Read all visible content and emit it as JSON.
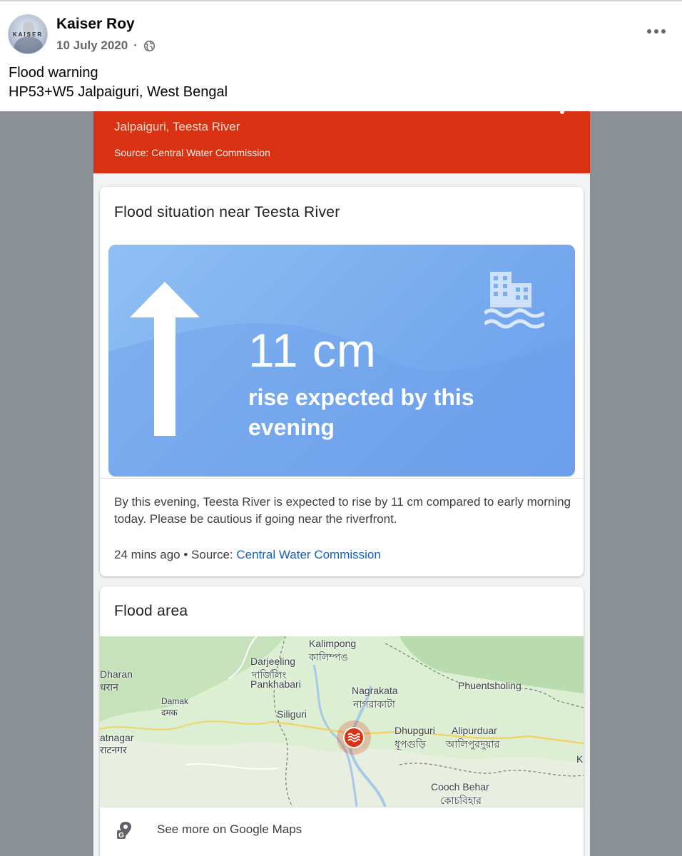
{
  "post": {
    "author": "Kaiser Roy",
    "avatar_text": "KAISER",
    "date": "10 July 2020",
    "separator": "·",
    "privacy_icon": "globe-icon",
    "more_icon": "more-options-icon",
    "text_line1": "Flood warning",
    "text_line2": "HP53+W5 Jalpaiguri, West Bengal"
  },
  "alert": {
    "location": "Jalpaiguri, Teesta River",
    "source": "Source: Central Water Commission",
    "color": "#d93212"
  },
  "situation_card": {
    "title": "Flood situation near Teesta River",
    "value": "11 cm",
    "caption": "rise expected by this evening",
    "arrow_icon": "up-arrow-icon",
    "building_icon": "flooded-building-icon",
    "description": "By this evening, Teesta River is expected to rise by 11 cm compared to early morning today. Please be cautious if going near the riverfront.",
    "time_ago": "24 mins ago",
    "source_prefix": "• Source:",
    "source_link": "Central Water Commission"
  },
  "area_card": {
    "title": "Flood area",
    "map_labels": {
      "kalimpong": "Kalimpong",
      "kalimpong_bn": "কালিম্পঙ",
      "darjeeling": "Darjeeling",
      "darjeeling_bn": "দার্জিলিং",
      "pankhabari": "Pankhabari",
      "dharan": "Dharan",
      "dharan_local": "धरान",
      "damak": "Damak",
      "damak_local": "दमक",
      "siliguri": "Siliguri",
      "nagrakata": "Nagrakata",
      "nagrakata_bn": "নাগরাকাটা",
      "phuentsholing": "Phuentsholing",
      "dhupguri": "Dhupguri",
      "dhupguri_bn": "ধূপগুড়ি",
      "alipurduar": "Alipurduar",
      "alipurduar_bn": "আলিপুরদুয়ার",
      "biratnagar": "atnagar",
      "biratnagar_local": "राटनगर",
      "cooch_behar": "Cooch Behar",
      "cooch_behar_bn": "কোচবিহার",
      "k_edge": "K"
    },
    "marker_icon": "flood-marker-icon",
    "maps_icon": "google-maps-icon",
    "maps_link": "See more on Google Maps"
  }
}
